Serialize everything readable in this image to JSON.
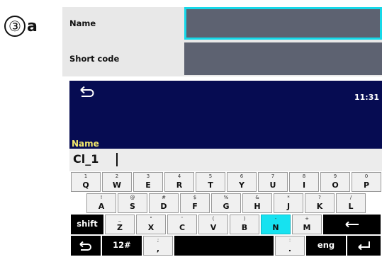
{
  "step": {
    "number": "③",
    "letter": "a"
  },
  "form": {
    "fields": [
      {
        "label": "Name",
        "value": "",
        "focused": true
      },
      {
        "label": "Short code",
        "value": ""
      }
    ],
    "colors": {
      "panel": "#e8e8e8",
      "field": "#5d6271",
      "focus": "#16d8e8"
    }
  },
  "device": {
    "topbar": {
      "back_icon": "back-arrow-icon",
      "time": "11:31",
      "color": "#060c52"
    },
    "field_title": "Name",
    "entry_value": "Cl_1",
    "keyboard": {
      "rows": [
        [
          {
            "sub": "1",
            "main": "Q"
          },
          {
            "sub": "2",
            "main": "W"
          },
          {
            "sub": "3",
            "main": "E"
          },
          {
            "sub": "4",
            "main": "R"
          },
          {
            "sub": "5",
            "main": "T"
          },
          {
            "sub": "6",
            "main": "Y"
          },
          {
            "sub": "7",
            "main": "U"
          },
          {
            "sub": "8",
            "main": "I"
          },
          {
            "sub": "9",
            "main": "O"
          },
          {
            "sub": "0",
            "main": "P"
          }
        ],
        [
          {
            "sub": "!",
            "main": "A"
          },
          {
            "sub": "@",
            "main": "S"
          },
          {
            "sub": "#",
            "main": "D"
          },
          {
            "sub": "$",
            "main": "F"
          },
          {
            "sub": "%",
            "main": "G"
          },
          {
            "sub": "&",
            "main": "H"
          },
          {
            "sub": "*",
            "main": "J"
          },
          {
            "sub": "?",
            "main": "K"
          },
          {
            "sub": "/",
            "main": "L"
          }
        ],
        [
          {
            "main": "shift",
            "type": "shift"
          },
          {
            "sub": "_",
            "main": "Z"
          },
          {
            "sub": "\"",
            "main": "X"
          },
          {
            "sub": "'",
            "main": "C"
          },
          {
            "sub": "(",
            "main": "V"
          },
          {
            "sub": ")",
            "main": "B"
          },
          {
            "sub": "-",
            "main": "N",
            "highlight": true
          },
          {
            "sub": "+",
            "main": "M"
          },
          {
            "main": "",
            "type": "backspace",
            "icon": "backspace-arrow-icon"
          }
        ],
        [
          {
            "main": "",
            "type": "back",
            "icon": "back-arrow-icon"
          },
          {
            "main": "12#",
            "type": "numbers"
          },
          {
            "sub": ";",
            "main": ","
          },
          {
            "main": "",
            "type": "space"
          },
          {
            "sub": ":",
            "main": "."
          },
          {
            "main": "eng",
            "type": "language"
          },
          {
            "main": "",
            "type": "enter",
            "icon": "enter-arrow-icon"
          }
        ]
      ],
      "highlight_color": "#16e2f0"
    }
  }
}
